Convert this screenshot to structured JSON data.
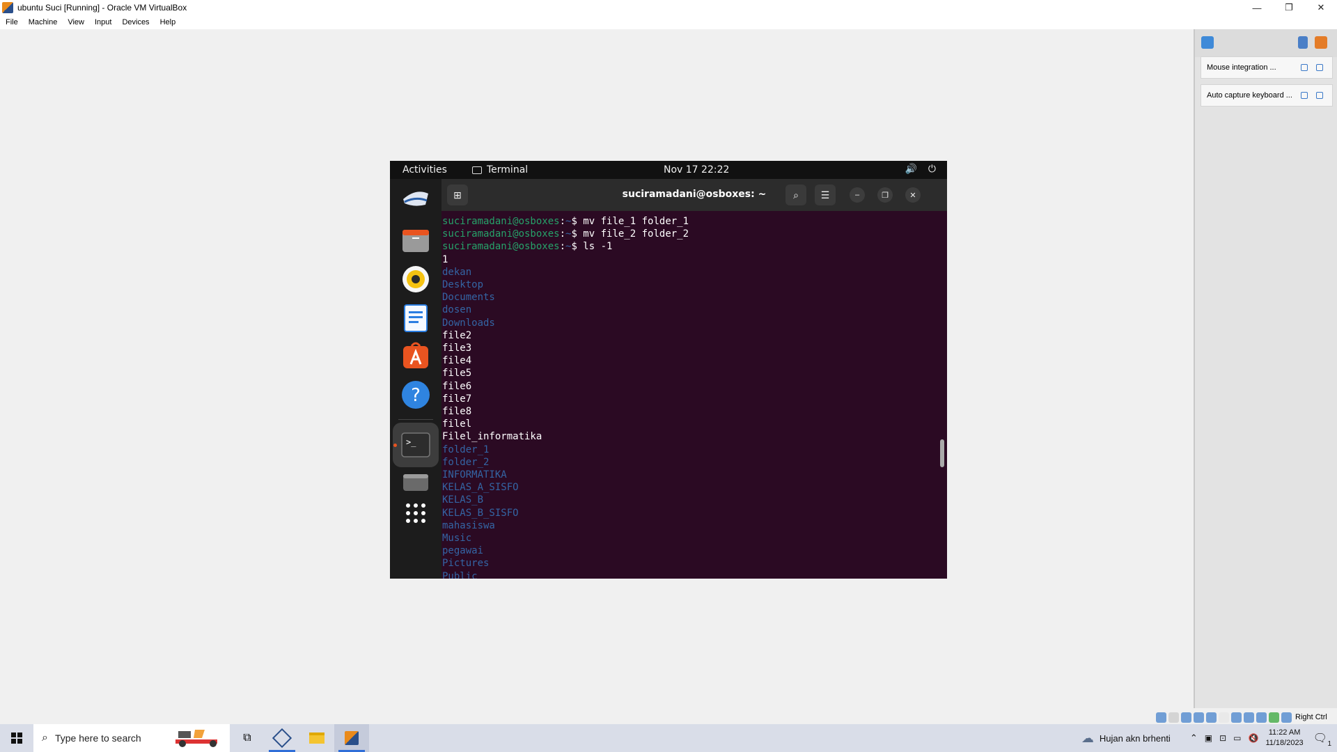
{
  "window": {
    "title": "ubuntu Suci [Running] - Oracle VM VirtualBox",
    "controls": [
      "—",
      "❐",
      "✕"
    ]
  },
  "menu": [
    "File",
    "Machine",
    "View",
    "Input",
    "Devices",
    "Help"
  ],
  "guest": {
    "topbar": {
      "activities": "Activities",
      "app": "Terminal",
      "clock": "Nov 17  22:22",
      "volume_icon": "🔊",
      "power_icon": "⏻"
    },
    "terminal": {
      "title": "suciramadani@osboxes: ~",
      "new_tab_icon": "⊞",
      "search_icon": "⌕",
      "menu_icon": "☰",
      "minimize_icon": "–",
      "maximize_icon": "❐",
      "close_icon": "✕",
      "lines": [
        {
          "type": "prompt",
          "user": "suciramadani@osboxes",
          "sep": ":",
          "path": "~",
          "cmd": "$ mv file_1 folder_1"
        },
        {
          "type": "prompt",
          "user": "suciramadani@osboxes",
          "sep": ":",
          "path": "~",
          "cmd": "$ mv file_2 folder_2"
        },
        {
          "type": "prompt",
          "user": "suciramadani@osboxes",
          "sep": ":",
          "path": "~",
          "cmd": "$ ls -1"
        },
        {
          "type": "file",
          "text": "1"
        },
        {
          "type": "dir",
          "text": "dekan"
        },
        {
          "type": "dir",
          "text": "Desktop"
        },
        {
          "type": "dir",
          "text": "Documents"
        },
        {
          "type": "dir",
          "text": "dosen"
        },
        {
          "type": "dir",
          "text": "Downloads"
        },
        {
          "type": "file",
          "text": "file2"
        },
        {
          "type": "file",
          "text": "file3"
        },
        {
          "type": "file",
          "text": "file4"
        },
        {
          "type": "file",
          "text": "file5"
        },
        {
          "type": "file",
          "text": "file6"
        },
        {
          "type": "file",
          "text": "file7"
        },
        {
          "type": "file",
          "text": "file8"
        },
        {
          "type": "file",
          "text": "filel"
        },
        {
          "type": "file",
          "text": "Filel_informatika"
        },
        {
          "type": "dir",
          "text": "folder_1"
        },
        {
          "type": "dir",
          "text": "folder_2"
        },
        {
          "type": "dir",
          "text": "INFORMATIKA"
        },
        {
          "type": "dir",
          "text": "KELAS_A_SISFO"
        },
        {
          "type": "dir",
          "text": "KELAS_B"
        },
        {
          "type": "dir",
          "text": "KELAS_B_SISFO"
        },
        {
          "type": "dir",
          "text": "mahasiswa"
        },
        {
          "type": "dir",
          "text": "Music"
        },
        {
          "type": "dir",
          "text": "pegawai"
        },
        {
          "type": "dir",
          "text": "Pictures"
        },
        {
          "type": "dir",
          "text": "Public"
        }
      ]
    },
    "dock": [
      "thunderbird-icon",
      "files-icon",
      "rhythmbox-icon",
      "writer-icon",
      "app-center-icon",
      "help-icon",
      "terminal-icon",
      "disk-icon",
      "show-apps-icon"
    ]
  },
  "notifications": [
    {
      "text": "Mouse integration ..."
    },
    {
      "text": "Auto capture keyboard ..."
    }
  ],
  "statusbar": {
    "host_key": "Right Ctrl"
  },
  "taskbar": {
    "search_placeholder": "Type here to search",
    "weather": "Hujan akn brhenti",
    "time": "11:22 AM",
    "date": "11/18/2023",
    "notification_count": "1"
  },
  "colors": {
    "terminal_bg": "#2b0a23",
    "prompt_user": "#26a269",
    "directory": "#3465a4",
    "ubuntu_orange": "#e95420"
  }
}
